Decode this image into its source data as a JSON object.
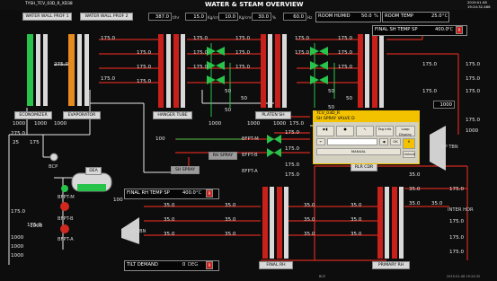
{
  "header": {
    "tag": "TYSH_TCV_03D_R_XD38",
    "title": "WATER & STEAM OVERVIEW",
    "date": "2019.01.08",
    "time": "19:24:32.486"
  },
  "nav": {
    "btn1": "WATER WALL PROF 1",
    "btn2": "WATER WALL PROF 2",
    "room_humid_label": "ROOM HUMID",
    "room_humid_value": "50.0",
    "room_humid_unit": "%",
    "room_temp_label": "ROOM TEMP",
    "room_temp_value": "25.0",
    "room_temp_unit": "°C"
  },
  "top_readouts": [
    {
      "value": "387.0",
      "unit": "t/hr"
    },
    {
      "value": "15.0",
      "unit": "Kg/cm²"
    },
    {
      "value": "10.0",
      "unit": "Kg/cm²"
    },
    {
      "value": "30.0",
      "unit": "%"
    },
    {
      "value": "60.0",
      "unit": "Hz"
    }
  ],
  "final_sh": {
    "label": "FINAL SH TEMP SP",
    "value": "400.0",
    "unit": "°C",
    "mode": "R"
  },
  "final_rh": {
    "label": "FINAL RH TEMP SP",
    "value": "400.0",
    "unit": "°C",
    "mode": "R"
  },
  "tilt": {
    "label": "TILT DEMAND",
    "value": "0",
    "unit": "DEG",
    "mode": "R"
  },
  "equipment": {
    "economizer": "ECONOMIZER",
    "evaporator": "EVAPORATOR",
    "hanger_tube": "HANGER TUBE",
    "platen_sh": "PLATEN SH",
    "final_sh": "FINAL SH",
    "final_rh": "FINAL RH",
    "primary_rh": "PRIMARY RH",
    "rlr_cdr": "RLR CDR",
    "dea": "DEA",
    "bcp": "BCP",
    "hp_tbn": "HP TBN",
    "ip_tbn": "IP TBN",
    "rh_spray": "RH SPRAY",
    "sh_spray": "SH SPRAY",
    "inter_hdr": "INTER HDR",
    "bfpt_m": "BFPT-M",
    "bfpt_b": "BFPT-B",
    "bfpt_a": "BFPT-A",
    "bfp_m": "BFP-M",
    "bfp_b": "BFP-B",
    "bfp_a": "BFP-A"
  },
  "values": {
    "econ_top": "175.0",
    "econ_mid": "275.0",
    "evap_top": "175.0",
    "econ_b1": "1000",
    "econ_b2": "1000",
    "econ_b3": "1000",
    "econ_b4": "275.0",
    "econ_b5": "25",
    "econ_b6": "175",
    "r1": "175.0",
    "r2": "175.0",
    "r3": "175.0",
    "r4": "175.0",
    "r5": "175.0",
    "r6": "175.0",
    "r7": "175.0",
    "r8": "175.0",
    "r9": "175.0",
    "r10": "175.0",
    "r11": "175.0",
    "r12": "175.0",
    "r13": "175.0",
    "r14": "175.0",
    "v50a": "50",
    "v50b": "50",
    "v50c": "50",
    "v50d": "50",
    "v50e": "50",
    "v50f": "50",
    "platen_b1": "1000",
    "platen_b2": "1000",
    "platen_b3": "1000",
    "platen_b4": "175.0",
    "far_r1": "175.0",
    "far_r2": "175.0",
    "far_r3": "175.0",
    "far_r4": "175.0",
    "far_r5": "175.0",
    "far_r6": "1000",
    "far_r7": "175.0",
    "far_r8": "1000",
    "spray_1": "100",
    "spray_2": "175.0",
    "spray_3": "175.0",
    "spray_4": "175.0",
    "spray_5": "175.0",
    "dea_1": "175.0",
    "dea_2": "1000",
    "dea_3": "1000",
    "dea_4": "1000",
    "dea_5": "175.0",
    "dea_6": "1000",
    "dea_7": "100",
    "rh_1": "35.0",
    "rh_2": "35.0",
    "rh_3": "35.0",
    "rh_4": "35.0",
    "rh_5": "35.0",
    "rh_6": "35.0",
    "rh_7": "35.0",
    "rh_8": "35.0",
    "rh_9": "35.0",
    "rh_10": "35.0",
    "rh_11": "35.0",
    "rh_12": "35.0",
    "rh_13": "35.0",
    "rh_14": "35.0",
    "rh_15": "35.0",
    "rh_16": "35.0",
    "prh_1": "175.0",
    "prh_2": "175.0",
    "prh_3": "175.0",
    "prh_4": "175.0"
  },
  "popup": {
    "tag": "TCV_03D_R",
    "desc": "SH SPRAY VALVE D",
    "buttons": [
      "",
      "",
      "",
      "Tag Info",
      "Loop Display"
    ],
    "manual": "MANUAL",
    "ok": "OK",
    "unlock": "Unlock"
  },
  "footer": {
    "tags": "BCE",
    "datetime": "2019-01-08 19:24:32"
  }
}
